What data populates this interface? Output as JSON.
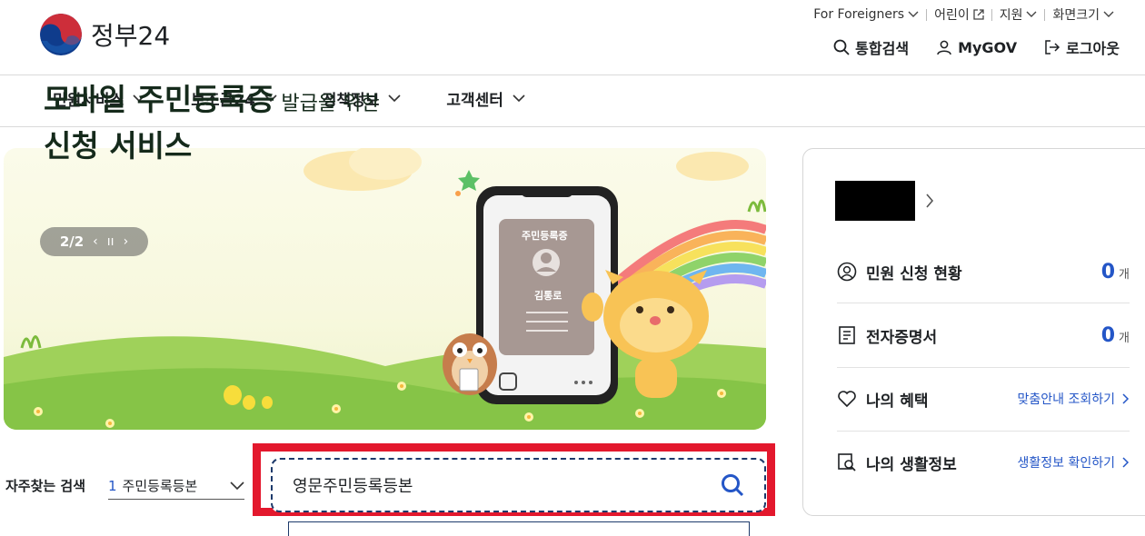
{
  "logo": {
    "text": "정부24"
  },
  "util": {
    "foreigners": "For Foreigners",
    "kids": "어린이",
    "support": "지원",
    "screen_size": "화면크기"
  },
  "top_buttons": {
    "search": "통합검색",
    "mygov": "MyGOV",
    "logout": "로그아웃"
  },
  "gnb": [
    "민원서비스",
    "보조금24",
    "정책정보",
    "고객센터"
  ],
  "banner": {
    "title_main": "모바일 주민등록증",
    "title_small": " 발급을 위한",
    "title_line2": "신청 서비스",
    "card_title": "주민등록증",
    "card_name": "김통로",
    "pager": "2/2"
  },
  "frequent_search": {
    "label": "자주찾는 검색",
    "selected_num": "1",
    "selected": "주민등록등본"
  },
  "search": {
    "value": "영문주민등록등본"
  },
  "panel": {
    "rows": [
      {
        "label": "민원 신청 현황",
        "count": "0",
        "unit": "개"
      },
      {
        "label": "전자증명서",
        "count": "0",
        "unit": "개"
      },
      {
        "label": "나의 혜택",
        "link": "맞춤안내 조회하기"
      },
      {
        "label": "나의 생활정보",
        "link": "생활정보 확인하기"
      }
    ]
  },
  "colors": {
    "accent": "#2456c7",
    "highlight": "#e3182d",
    "brand_red": "#cd2e3a",
    "brand_blue": "#0f3c8c"
  }
}
